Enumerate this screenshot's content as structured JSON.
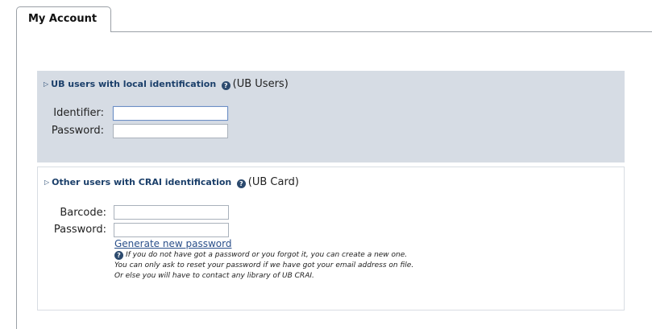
{
  "tab": {
    "label": "My Account"
  },
  "section_ub": {
    "heading_bold": "UB users with local identification",
    "heading_suffix": "(UB Users)",
    "identifier_label": "Identifier:",
    "identifier_value": "",
    "password_label": "Password:",
    "password_value": ""
  },
  "section_crai": {
    "heading_bold": "Other users with CRAI identification",
    "heading_suffix": "(UB Card)",
    "barcode_label": "Barcode:",
    "barcode_value": "",
    "password_label": "Password:",
    "password_value": "",
    "generate_link": "Generate new password",
    "note_line1": "If you do not have got a password or you forgot it, you can create a new one.",
    "note_line2": "You can only ask to reset your password if we have got your email address on file.",
    "note_line3": "Or else you will have to contact any library of UB CRAI."
  },
  "icons": {
    "expand": "triangle-right-icon",
    "help": "help-circle-icon"
  },
  "colors": {
    "accent": "#1b3f6a",
    "section_bg": "#d6dce4",
    "link": "#2a4f8a"
  }
}
